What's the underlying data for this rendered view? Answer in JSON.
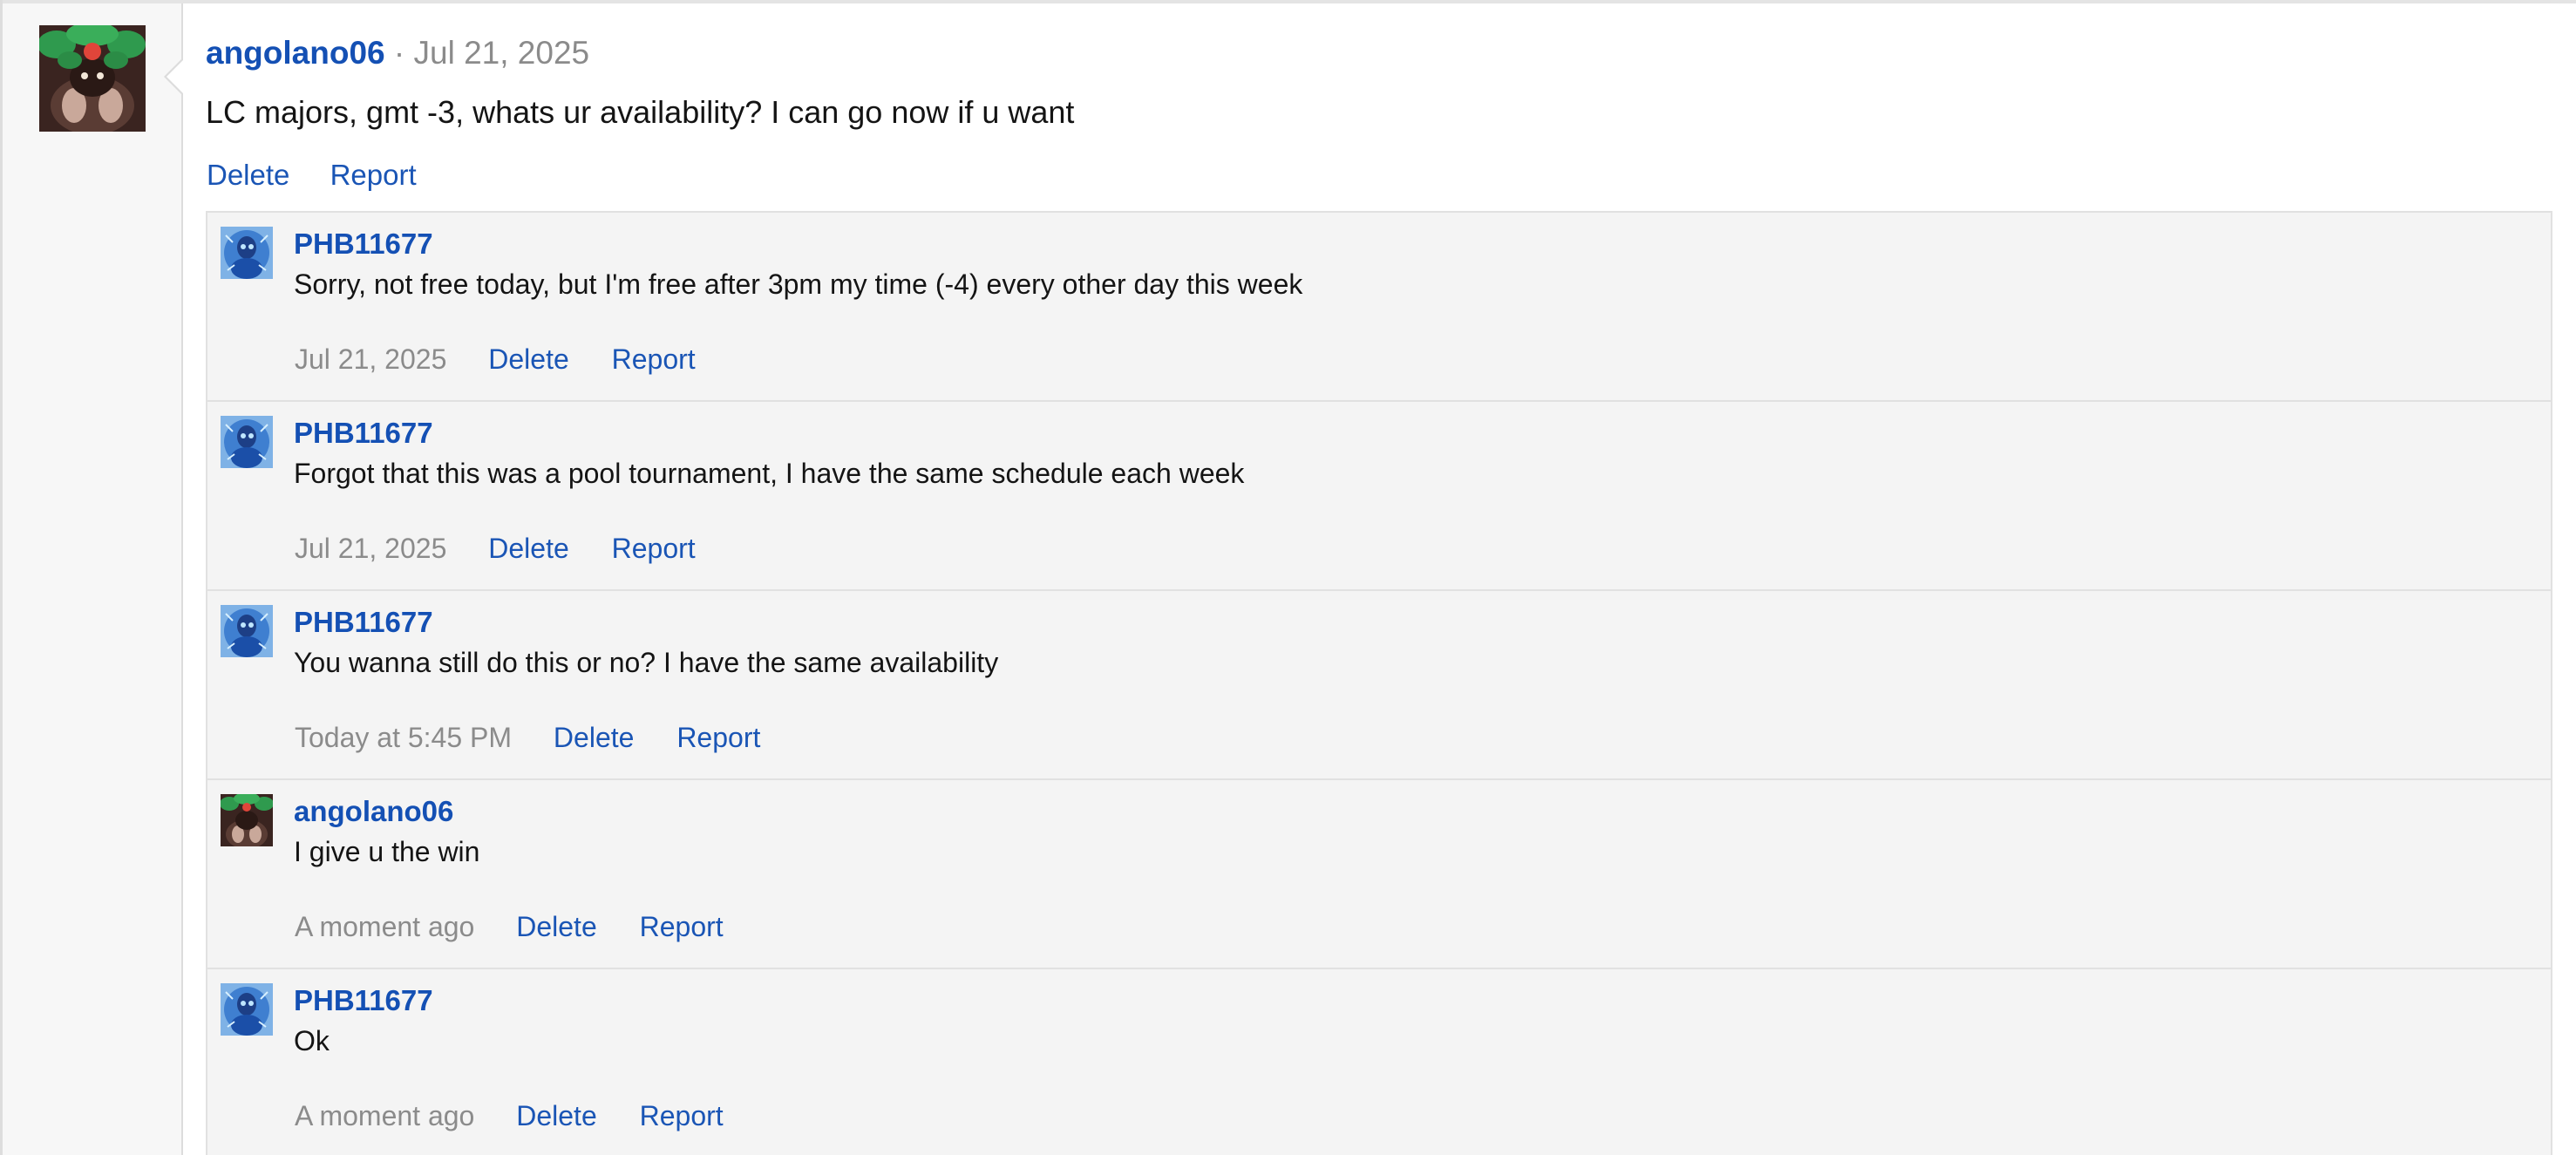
{
  "post": {
    "author": "angolano06",
    "separator": "·",
    "date": "Jul 21, 2025",
    "body": "LC majors, gmt -3, whats ur availability? I can go now if u want",
    "actions": {
      "delete_label": "Delete",
      "report_label": "Report"
    }
  },
  "comments": [
    {
      "author": "PHB11677",
      "avatar_icon": "blue-glowing-figure-avatar",
      "body": "Sorry, not free today, but I'm free after 3pm my time (-4) every other day this week",
      "time": "Jul 21, 2025",
      "delete_label": "Delete",
      "report_label": "Report"
    },
    {
      "author": "PHB11677",
      "avatar_icon": "blue-glowing-figure-avatar",
      "body": "Forgot that this was a pool tournament, I have the same schedule each week",
      "time": "Jul 21, 2025",
      "delete_label": "Delete",
      "report_label": "Report"
    },
    {
      "author": "PHB11677",
      "avatar_icon": "blue-glowing-figure-avatar",
      "body": "You wanna still do this or no? I have the same availability",
      "time": "Today at 5:45 PM",
      "delete_label": "Delete",
      "report_label": "Report"
    },
    {
      "author": "angolano06",
      "avatar_icon": "dark-creature-with-leaves-avatar",
      "body": "I give u the win",
      "time": "A moment ago",
      "delete_label": "Delete",
      "report_label": "Report"
    },
    {
      "author": "PHB11677",
      "avatar_icon": "blue-glowing-figure-avatar",
      "body": "Ok",
      "time": "A moment ago",
      "delete_label": "Delete",
      "report_label": "Report"
    }
  ],
  "colors": {
    "link": "#1a55b5",
    "username": "#1450b4",
    "muted": "#8b8b8b",
    "comment_bg": "#f4f4f4",
    "border": "#e1e1e1"
  }
}
